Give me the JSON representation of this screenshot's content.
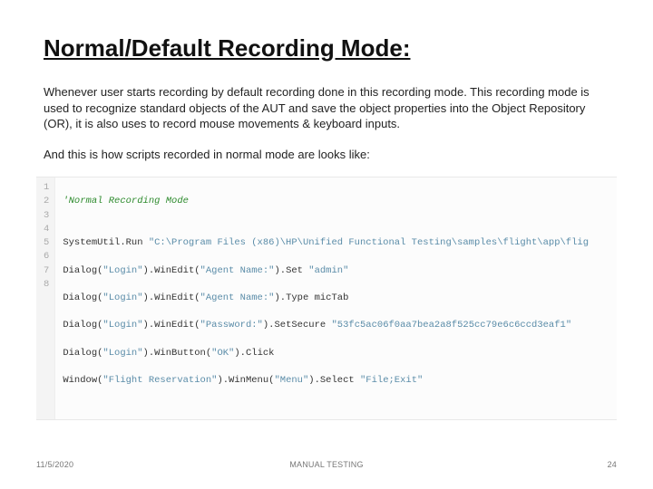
{
  "title": "Normal/Default Recording Mode:",
  "paragraphs": {
    "p1": "Whenever user starts recording by default recording done in this recording mode. This recording mode is used to recognize standard objects of the AUT and save the object properties into the Object Repository (OR), it is also uses to record mouse movements & keyboard inputs.",
    "p2": "And this is how scripts recorded in normal mode are looks like:"
  },
  "code": {
    "gutter": [
      "1",
      "2",
      "3",
      "4",
      "5",
      "6",
      "7",
      "8"
    ],
    "lines": {
      "l1_comment": "'Normal Recording Mode",
      "l2": "",
      "l3_a": "SystemUtil.Run ",
      "l3_b": "\"C:\\Program Files (x86)\\HP\\Unified Functional Testing\\samples\\flight\\app\\flig",
      "l4_a": "Dialog(",
      "l4_b": "\"Login\"",
      "l4_c": ").WinEdit(",
      "l4_d": "\"Agent Name:\"",
      "l4_e": ").Set ",
      "l4_f": "\"admin\"",
      "l5_a": "Dialog(",
      "l5_b": "\"Login\"",
      "l5_c": ").WinEdit(",
      "l5_d": "\"Agent Name:\"",
      "l5_e": ").Type micTab",
      "l6_a": "Dialog(",
      "l6_b": "\"Login\"",
      "l6_c": ").WinEdit(",
      "l6_d": "\"Password:\"",
      "l6_e": ").SetSecure ",
      "l6_f": "\"53fc5ac06f0aa7bea2a8f525cc79e6c6ccd3eaf1\"",
      "l7_a": "Dialog(",
      "l7_b": "\"Login\"",
      "l7_c": ").WinButton(",
      "l7_d": "\"OK\"",
      "l7_e": ").Click",
      "l8_a": "Window(",
      "l8_b": "\"Flight Reservation\"",
      "l8_c": ").WinMenu(",
      "l8_d": "\"Menu\"",
      "l8_e": ").Select ",
      "l8_f": "\"File;Exit\""
    }
  },
  "footer": {
    "date": "11/5/2020",
    "center": "MANUAL TESTING",
    "page": "24"
  }
}
